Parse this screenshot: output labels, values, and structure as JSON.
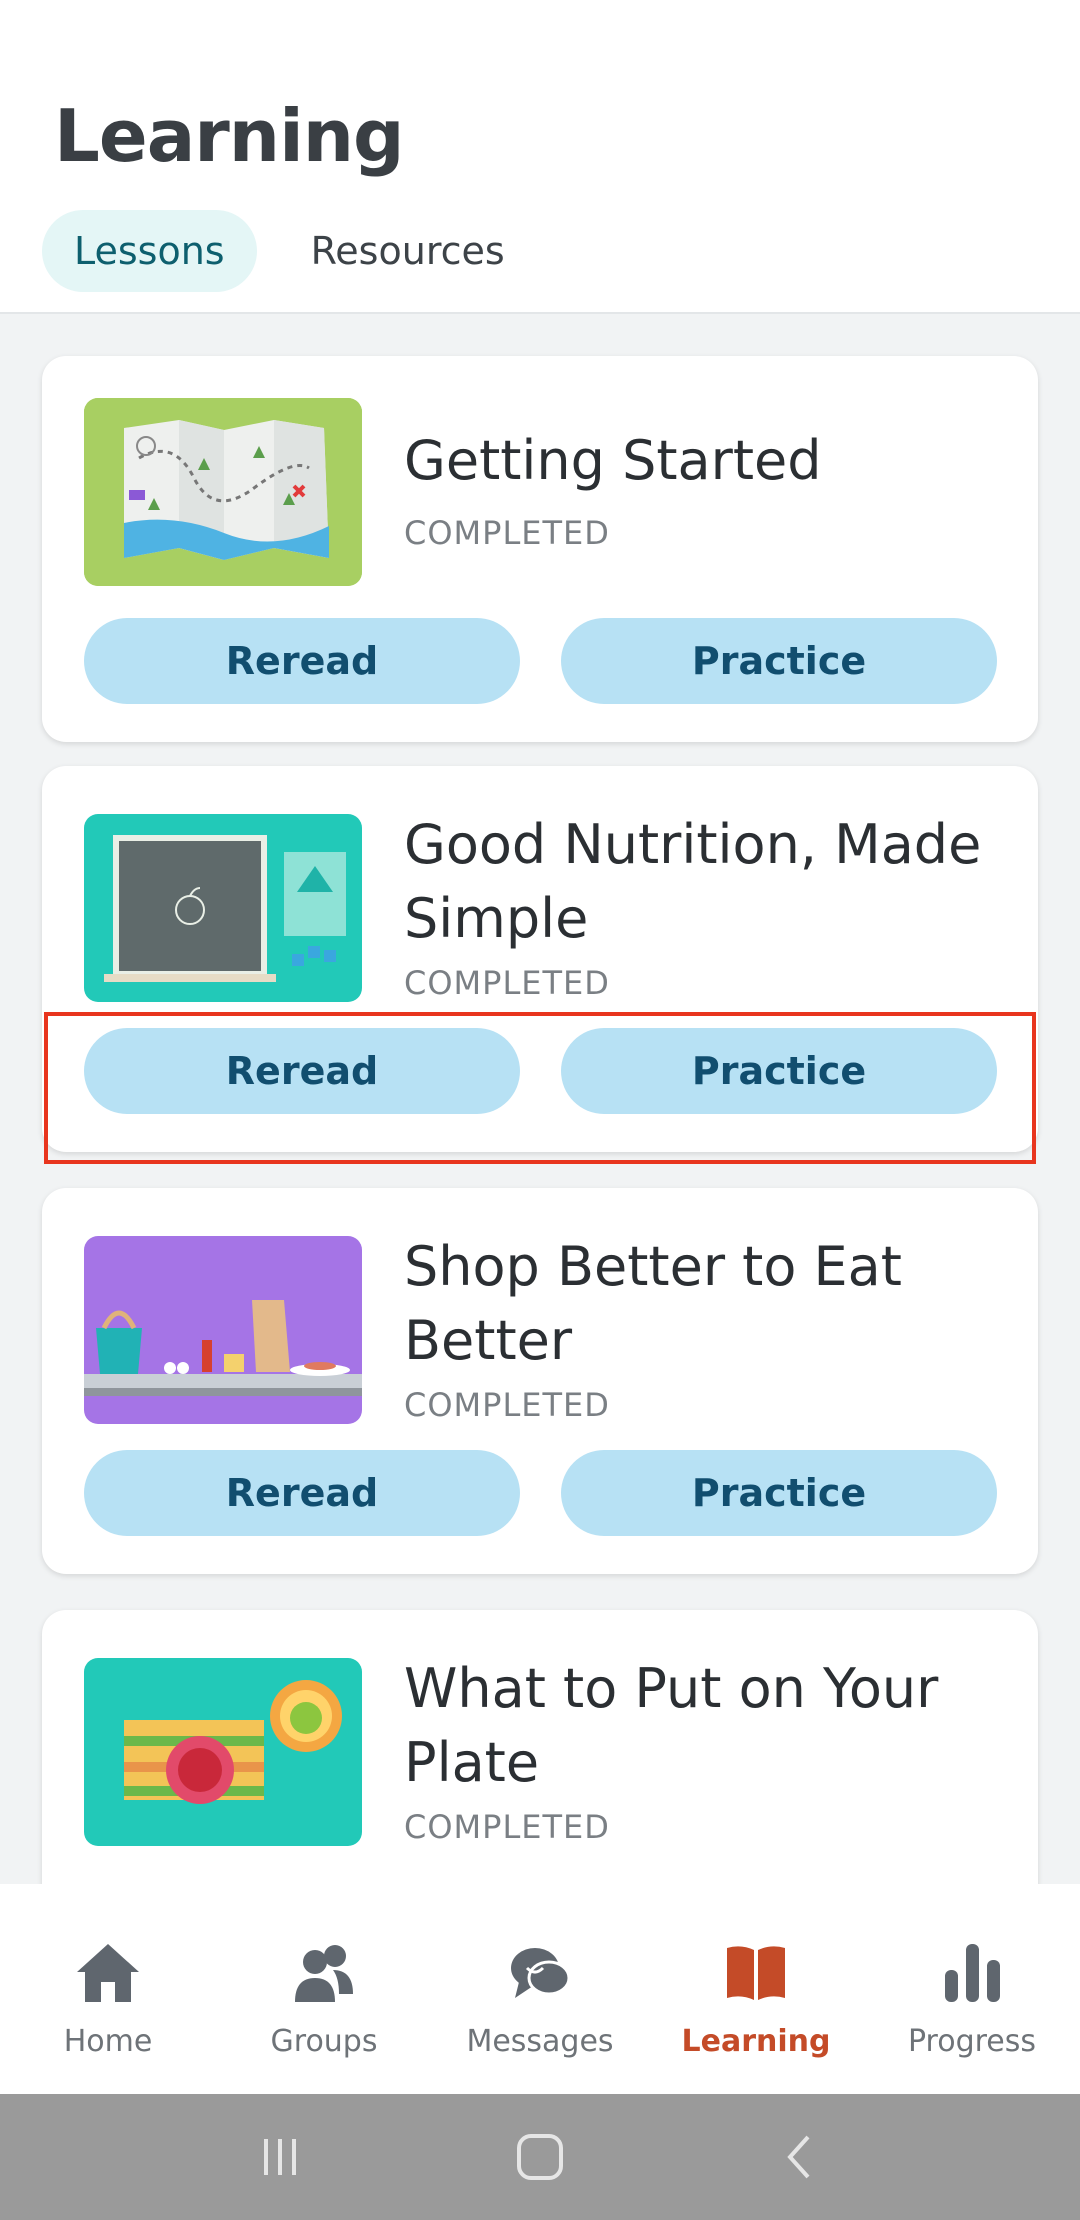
{
  "header": {
    "title": "Learning",
    "tabs": [
      {
        "label": "Lessons",
        "active": true
      },
      {
        "label": "Resources",
        "active": false
      }
    ]
  },
  "lessons": [
    {
      "title": "Getting Started",
      "status": "COMPLETED",
      "reread_label": "Reread",
      "practice_label": "Practice",
      "image": "treasure-map-illustration"
    },
    {
      "title": "Good Nutrition, Made Simple",
      "status": "COMPLETED",
      "reread_label": "Reread",
      "practice_label": "Practice",
      "image": "chalkboard-apple-illustration"
    },
    {
      "title": "Shop Better to Eat Better",
      "status": "COMPLETED",
      "reread_label": "Reread",
      "practice_label": "Practice",
      "image": "grocery-shelf-illustration"
    },
    {
      "title": "What to Put on Your Plate",
      "status": "COMPLETED",
      "image": "food-plate-illustration"
    }
  ],
  "bottom_nav": [
    {
      "label": "Home",
      "icon": "home-icon",
      "active": false
    },
    {
      "label": "Groups",
      "icon": "groups-icon",
      "active": false
    },
    {
      "label": "Messages",
      "icon": "messages-icon",
      "active": false
    },
    {
      "label": "Learning",
      "icon": "book-icon",
      "active": true
    },
    {
      "label": "Progress",
      "icon": "bar-chart-icon",
      "active": false
    }
  ],
  "colors": {
    "accent_active_nav": "#c44b28",
    "button_bg": "#b7e1f4",
    "button_text": "#114e6f",
    "tab_active_bg": "#e4f6f6",
    "highlight_box": "#e8351e"
  }
}
